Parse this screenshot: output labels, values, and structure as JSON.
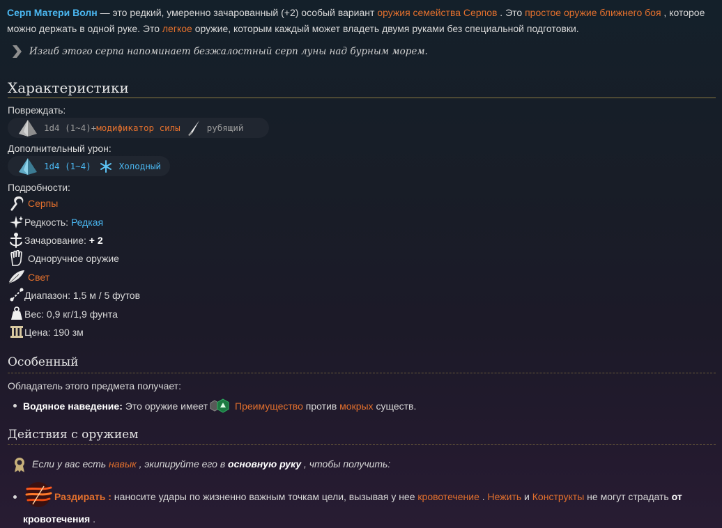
{
  "intro": {
    "item_name": "Серп Матери Волн",
    "t1": " — это редкий, умеренно зачарованный (+2) особый вариант ",
    "link1": "оружия семейства Серпов",
    "t2": " . Это ",
    "link2": "простое оружие ближнего боя",
    "t3": " , которое",
    "line2_t1": "можно держать в одной руке. Это ",
    "link3": "легкое",
    "line2_t2": " оружие, которым каждый может владеть двумя руками без специальной подготовки."
  },
  "quote": "Изгиб этого серпа напоминает безжалостный серп луны над бурным морем.",
  "characteristics": {
    "title": "Характеристики",
    "damage_label": "Повреждать:",
    "damage_dice": "1d4 (1~4)",
    "damage_plus": " + ",
    "damage_mod": "модификатор силы",
    "damage_type": "рубящий",
    "extra_label": "Дополнительный урон:",
    "extra_dice": "1d4 (1~4)",
    "extra_type": "Холодный",
    "details_label": "Подробности:",
    "details": {
      "family": "Серпы",
      "rarity_label": "Редкость: ",
      "rarity_value": "Редкая",
      "enchant_label": "Зачарование: ",
      "enchant_value": "+ 2",
      "handed": "Одноручное оружие",
      "light": "Свет",
      "range": "Диапазон: 1,5 м / 5 футов",
      "weight": "Вес: 0,9 кг/1,9 фунта",
      "price": "Цена: 190 зм"
    }
  },
  "special": {
    "title": "Особенный",
    "intro": "Обладатель этого предмета получает:",
    "item_name": "Водяное наведение:",
    "t1": " Это оружие имеет ",
    "advantage": "Преимущество",
    "t2": " против ",
    "wet": "мокрых",
    "t3": " существ."
  },
  "actions": {
    "title": "Действия с оружием",
    "note_t1": "Если у вас есть ",
    "note_link": "навык",
    "note_t2": " , экипируйте его в ",
    "note_bold": "основную руку",
    "note_t3": " , чтобы получить:",
    "action_name": "Раздирать :",
    "action_t1": " наносите удары по жизненно важным точкам цели, вызывая у нее ",
    "action_link1": "кровотечение",
    "action_t2": " . ",
    "action_link2": "Нежить",
    "action_t3": " и ",
    "action_link3": "Конструкты",
    "action_t4": " не могут страдать ",
    "action_bold1": "от",
    "action_bold2": "кровотечения",
    "action_t5": " ."
  },
  "colors": {
    "link": "#e3702d",
    "item_name": "#4bb8f2",
    "cold": "#4bb8f2",
    "rule": "#8a7a42"
  },
  "icons": [
    "quote-arrow-icon",
    "d4-die-icon",
    "slashing-blade-icon",
    "d4-cold-die-icon",
    "snowflake-icon",
    "sickle-icon",
    "rarity-sparkle-icon",
    "enchantment-icon",
    "one-hand-icon",
    "light-feather-icon",
    "range-icon",
    "weight-icon",
    "price-icon",
    "advantage-icon",
    "skill-badge-icon",
    "lacerate-action-icon"
  ]
}
